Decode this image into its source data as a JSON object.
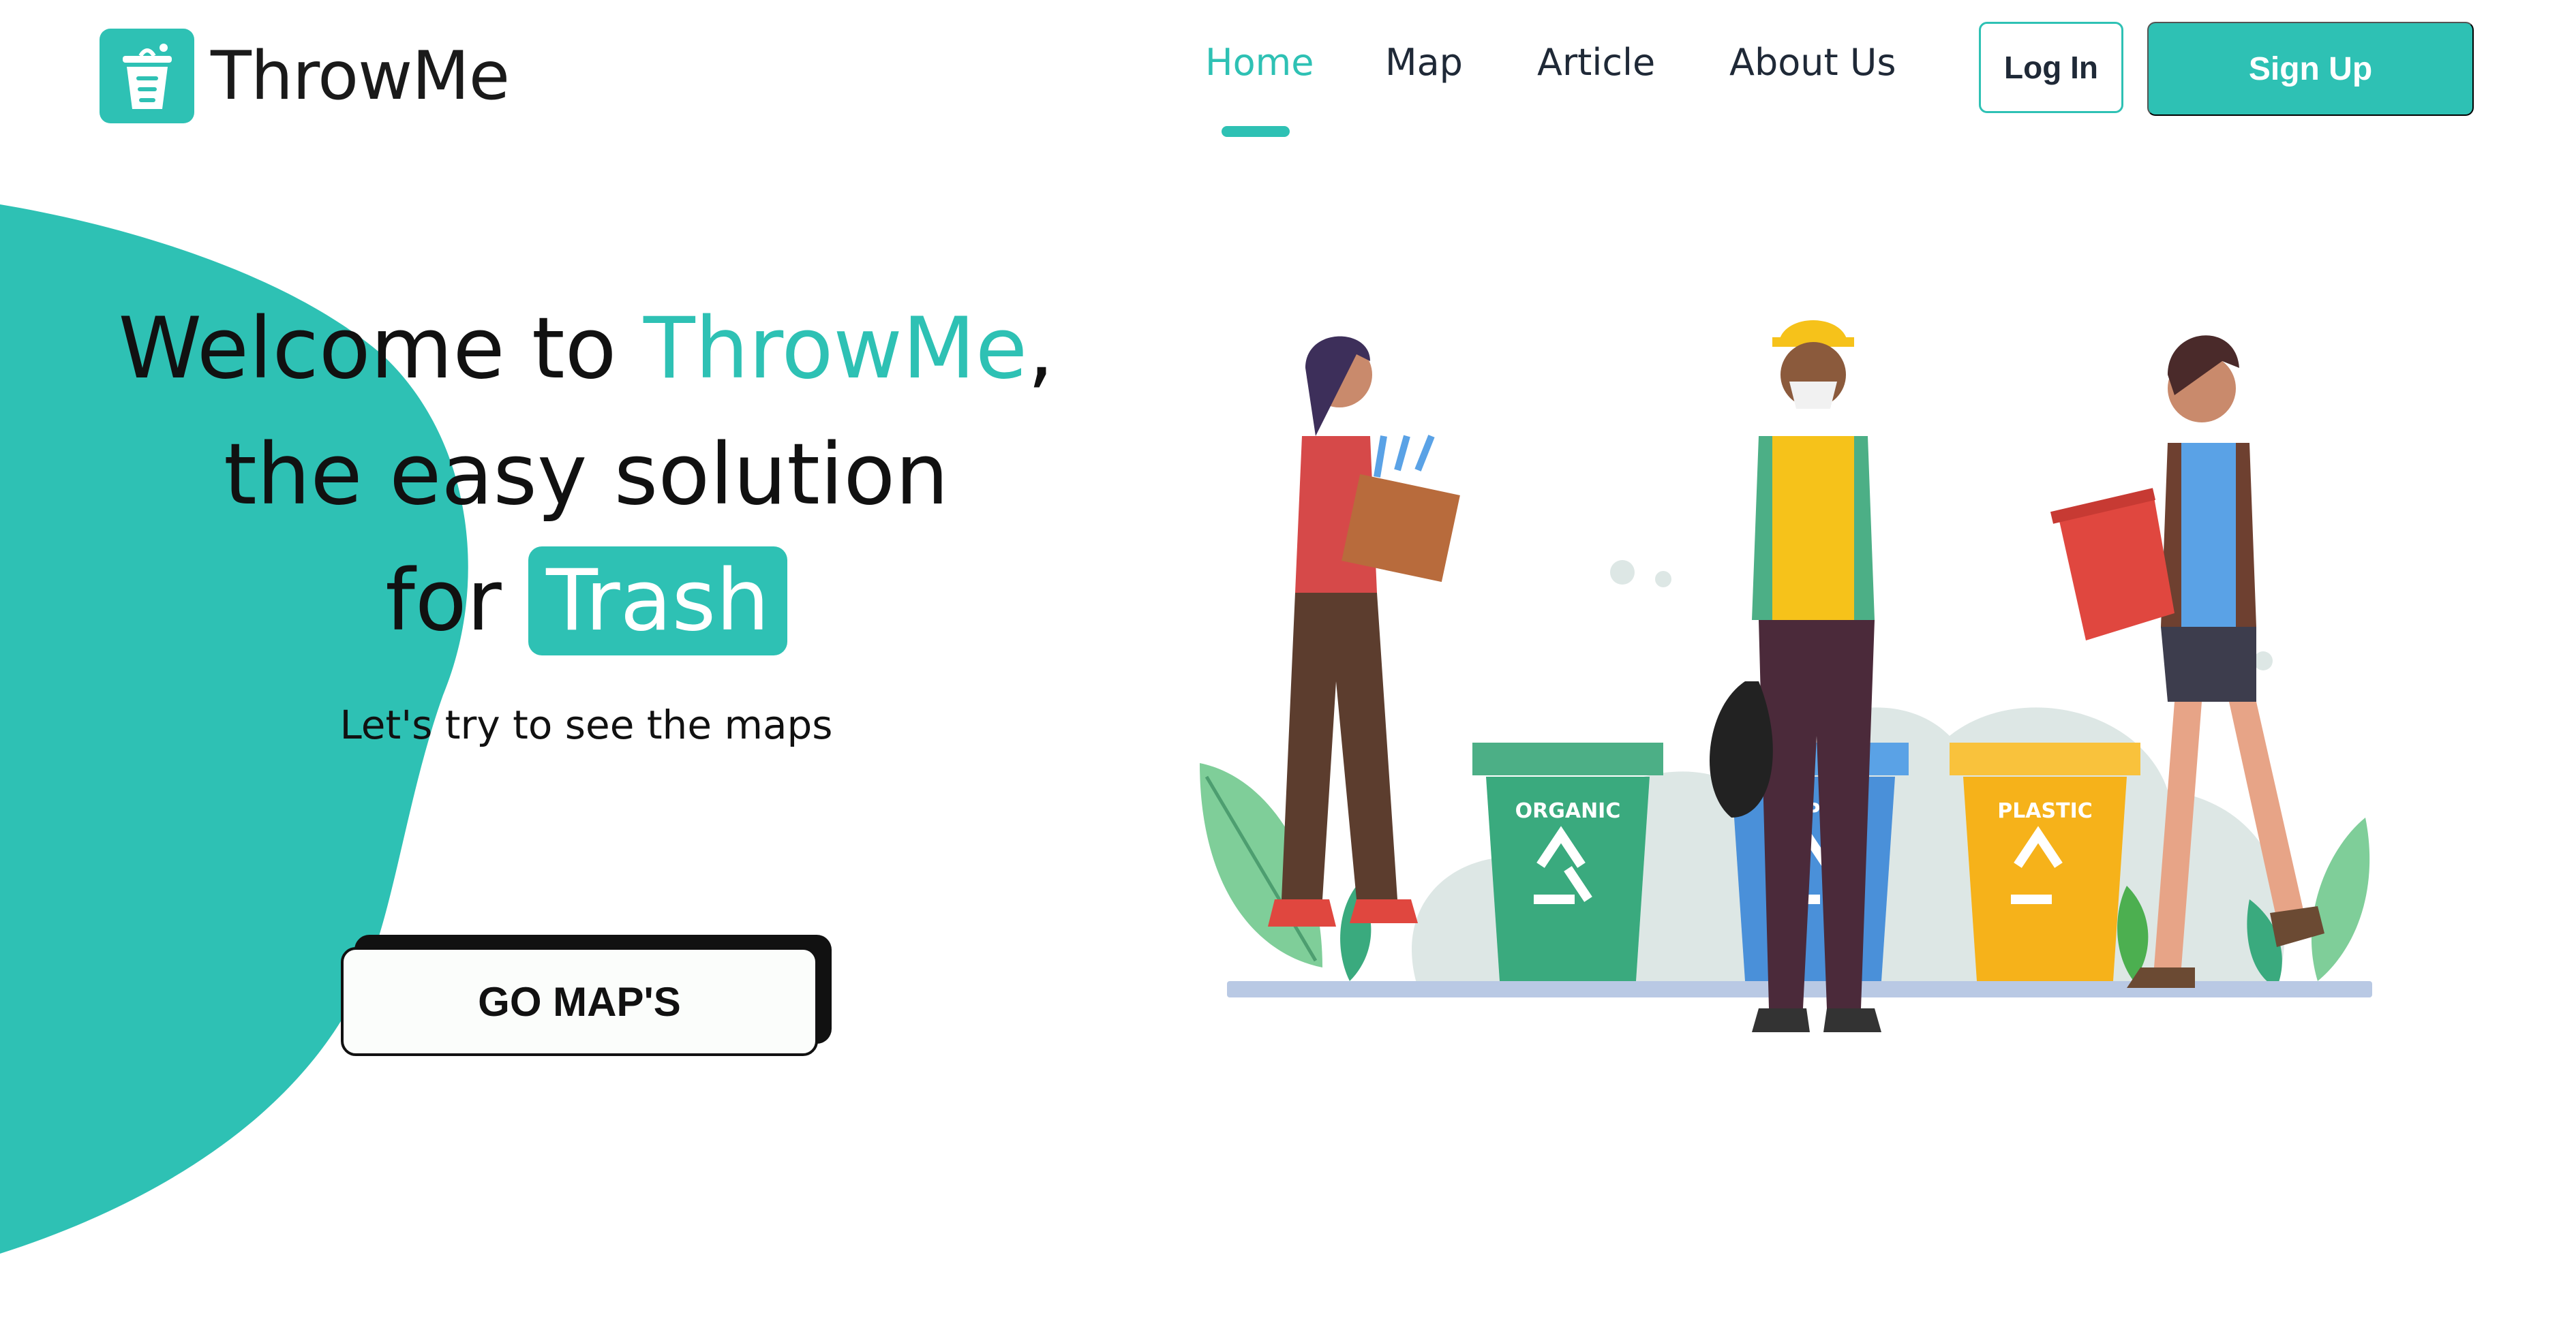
{
  "brand": {
    "name": "ThrowMe",
    "accent_color": "#2ec1b4",
    "logo_icon": "trash-bin-icon"
  },
  "nav": {
    "items": [
      {
        "label": "Home",
        "active": true
      },
      {
        "label": "Map",
        "active": false
      },
      {
        "label": "Article",
        "active": false
      },
      {
        "label": "About Us",
        "active": false
      }
    ],
    "login_label": "Log In",
    "signup_label": "Sign Up"
  },
  "hero": {
    "line1_prefix": "Welcome to ",
    "line1_accent": "ThrowMe",
    "line1_suffix": ",",
    "line2": "the easy solution",
    "line3_prefix": "for ",
    "line3_pill": "Trash",
    "subtitle": "Let's try to see the maps",
    "cta_label": "GO MAP'S"
  },
  "illustration": {
    "bins": [
      {
        "label": "ORGANIC",
        "color": "#3aaa7e"
      },
      {
        "label": "PAPER",
        "color": "#4a90d9"
      },
      {
        "label": "PLASTIC",
        "color": "#f6b21a"
      }
    ]
  }
}
